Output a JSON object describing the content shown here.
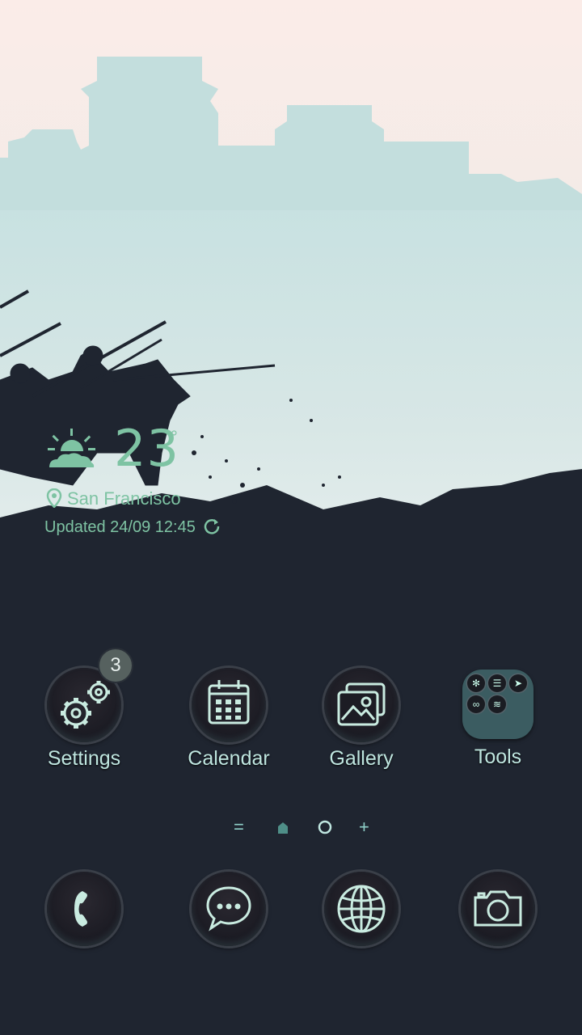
{
  "weather": {
    "icon": "partly-sunny-icon",
    "temperature": "23",
    "unit": "°",
    "location": "San Francisco",
    "updated": "Updated 24/09 12:45"
  },
  "apps": [
    {
      "label": "Settings",
      "icon": "settings-gears-icon",
      "badge": "3"
    },
    {
      "label": "Calendar",
      "icon": "calendar-icon"
    },
    {
      "label": "Gallery",
      "icon": "gallery-icon"
    },
    {
      "label": "Tools",
      "icon": "folder-icon"
    }
  ],
  "pager": {
    "items": [
      "=",
      "home-dot-icon",
      "page-dot-icon",
      "+"
    ]
  },
  "dock": [
    {
      "icon": "phone-icon"
    },
    {
      "icon": "messages-icon"
    },
    {
      "icon": "browser-globe-icon"
    },
    {
      "icon": "camera-icon"
    }
  ],
  "colors": {
    "accent": "#7ec3a3",
    "background": "#1f2530",
    "label": "#bfe6e0",
    "badge": "#56615f"
  }
}
